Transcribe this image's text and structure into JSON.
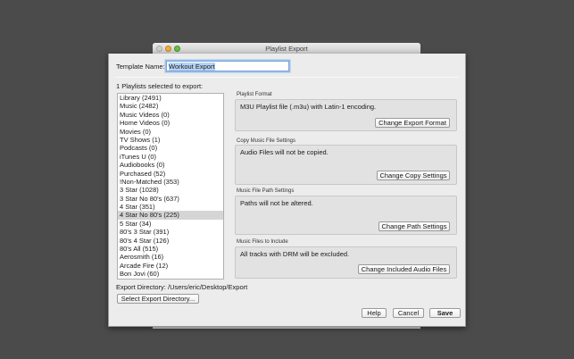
{
  "window": {
    "title": "Playlist Export"
  },
  "template": {
    "label": "Template Name:",
    "value": "Workout Export"
  },
  "playlists": {
    "heading": "1 Playlists selected to export:",
    "selected_index": 14,
    "items": [
      "Library (2491)",
      "Music (2482)",
      "Music Videos (0)",
      "Home Videos (0)",
      "Movies (0)",
      "TV Shows (1)",
      "Podcasts (0)",
      "iTunes U (0)",
      "Audiobooks (0)",
      "Purchased (52)",
      "!Non-Matched (353)",
      "3 Star (1028)",
      "3 Star No 80's (637)",
      "4 Star (351)",
      "4 Star No 80's (225)",
      "5 Star (34)",
      "80's 3 Star (391)",
      "80's 4 Star (126)",
      "80's All (515)",
      "Aerosmith (16)",
      "Arcade Fire (12)",
      "Bon Jovi (60)"
    ]
  },
  "groups": [
    {
      "label": "Playlist Format",
      "message": "M3U Playlist file (.m3u) with Latin-1 encoding.",
      "button": "Change Export Format"
    },
    {
      "label": "Copy Music File Settings",
      "message": "Audio Files will not be copied.",
      "button": "Change Copy Settings"
    },
    {
      "label": "Music File Path Settings",
      "message": "Paths will not be altered.",
      "button": "Change Path Settings"
    },
    {
      "label": "Music Files to Include",
      "message": "All tracks with DRM will be excluded.",
      "button": "Change Included Audio Files"
    }
  ],
  "export_dir": {
    "label": "Export Directory:",
    "path": "/Users/eric/Desktop/Export",
    "button": "Select Export Directory..."
  },
  "actions": {
    "help": "Help",
    "cancel": "Cancel",
    "save": "Save"
  }
}
